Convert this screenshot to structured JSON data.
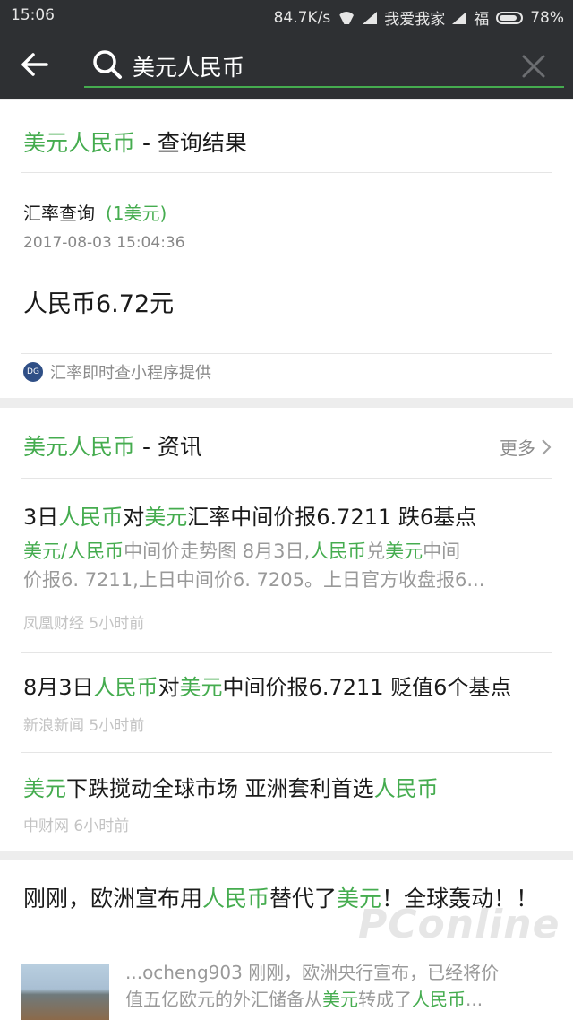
{
  "status_bar": {
    "time": "15:06",
    "speed": "84.7K/s",
    "carrier1": "我爱我家",
    "carrier2": "福",
    "battery": "78%"
  },
  "search": {
    "query": "美元人民币",
    "back_icon": "back-arrow-icon",
    "search_icon": "search-icon",
    "clear_icon": "close-icon"
  },
  "rate_card": {
    "title_highlight": "美元人民币",
    "title_suffix": " - 查询结果",
    "label": "汇率查询",
    "unit": "(1美元)",
    "timestamp": "2017-08-03 15:04:36",
    "value": "人民币6.72元",
    "provider_logo_text": "DG",
    "provider": "汇率即时查小程序提供"
  },
  "news_card": {
    "title_highlight": "美元人民币",
    "title_suffix": " - 资讯",
    "more_label": "更多",
    "items": [
      {
        "title": [
          "3日",
          "人民币",
          "对",
          "美元",
          "汇率中间价报6.7211 跌6基点"
        ],
        "snippet_line1": [
          "美元",
          "/",
          "人民币",
          "中间价走势图 8月3日,",
          "人民币",
          "兑",
          "美元",
          "中间"
        ],
        "snippet_line2": "价报6. 7211,上日中间价6. 7205。上日官方收盘报6...",
        "meta": "凤凰财经 5小时前"
      },
      {
        "title": [
          "8月3日",
          "人民币",
          "对",
          "美元",
          "中间价报6.7211 贬值6个基点"
        ],
        "meta": "新浪新闻 5小时前"
      },
      {
        "title": [
          "美元",
          "下跌搅动全球市场 亚洲套利首选",
          "人民币"
        ],
        "meta": "中财网 6小时前"
      }
    ]
  },
  "article_card": {
    "title": [
      "刚刚，欧洲宣布用",
      "人民币",
      "替代了",
      "美元",
      "！全球轰动！！"
    ],
    "snippet_line1": "...ocheng903 刚刚，欧洲央行宣布，已经将价",
    "snippet_line2": [
      "值五亿欧元的外汇储备从",
      "美元",
      "转成了",
      "人民币",
      "..."
    ]
  },
  "watermark": "PConline",
  "colors": {
    "accent": "#45ac4f",
    "header_bg": "#2e3033",
    "page_bg": "#ededed"
  }
}
